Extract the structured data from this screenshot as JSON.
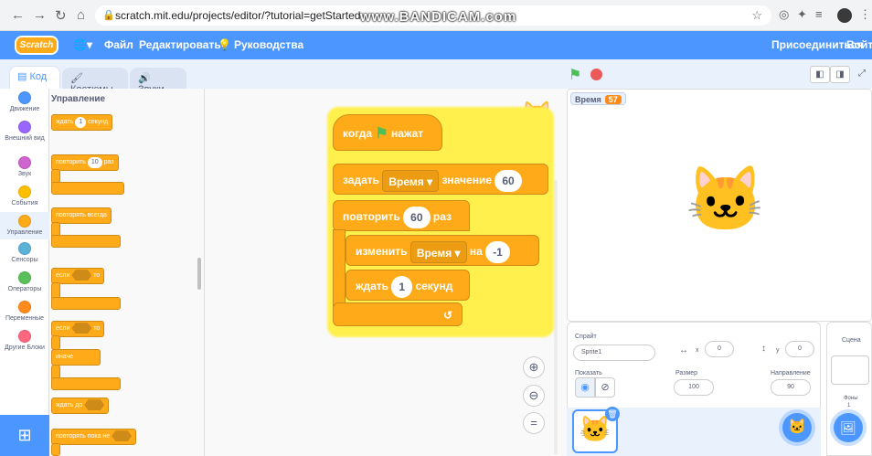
{
  "browser": {
    "url": "scratch.mit.edu/projects/editor/?tutorial=getStarted",
    "watermark": "www.BANDICAM.com"
  },
  "menu": {
    "logo": "Scratch",
    "file": "Файл",
    "edit": "Редактировать",
    "tutorials": "Руководства",
    "join": "Присоединиться",
    "signin": "Войти"
  },
  "tabs": {
    "code": "Код",
    "costumes": "Костюмы",
    "sounds": "Звуки"
  },
  "categories": [
    {
      "label": "Движение",
      "color": "#4c97ff"
    },
    {
      "label": "Внешний вид",
      "color": "#9966ff"
    },
    {
      "label": "Звук",
      "color": "#cf63cf"
    },
    {
      "label": "События",
      "color": "#ffbf00"
    },
    {
      "label": "Управление",
      "color": "#ffab19"
    },
    {
      "label": "Сенсоры",
      "color": "#5cb1d6"
    },
    {
      "label": "Операторы",
      "color": "#59c059"
    },
    {
      "label": "Переменные",
      "color": "#ff8c1a"
    },
    {
      "label": "Другие Блоки",
      "color": "#ff6680"
    }
  ],
  "palette": {
    "header": "Управление",
    "wait": "ждать",
    "wait_val": "1",
    "seconds": "секунд",
    "repeat": "повторить",
    "repeat_val": "10",
    "times": "раз",
    "forever": "повторять всегда",
    "if": "если",
    "then": "то",
    "else": "иначе",
    "wait_until": "ждать до",
    "repeat_until": "повторять пока не"
  },
  "script": {
    "when": "когда",
    "clicked": "нажат",
    "set": "задать",
    "var": "Время",
    "to": "значение",
    "set_val": "60",
    "repeat": "повторить",
    "repeat_val": "60",
    "times": "раз",
    "change": "изменить",
    "by": "на",
    "change_val": "-1",
    "wait": "ждать",
    "wait_val": "1",
    "seconds": "секунд"
  },
  "stage": {
    "monitor_label": "Время",
    "monitor_value": "57"
  },
  "sprite": {
    "label": "Спрайт",
    "name": "Sprite1",
    "x_label": "x",
    "x": "0",
    "y_label": "y",
    "y": "0",
    "show_label": "Показать",
    "size_label": "Размер",
    "size": "100",
    "direction_label": "Направление",
    "direction": "90"
  },
  "stage_panel": {
    "label": "Сцена",
    "backdrops": "Фоны",
    "backdrops_count": "1"
  }
}
